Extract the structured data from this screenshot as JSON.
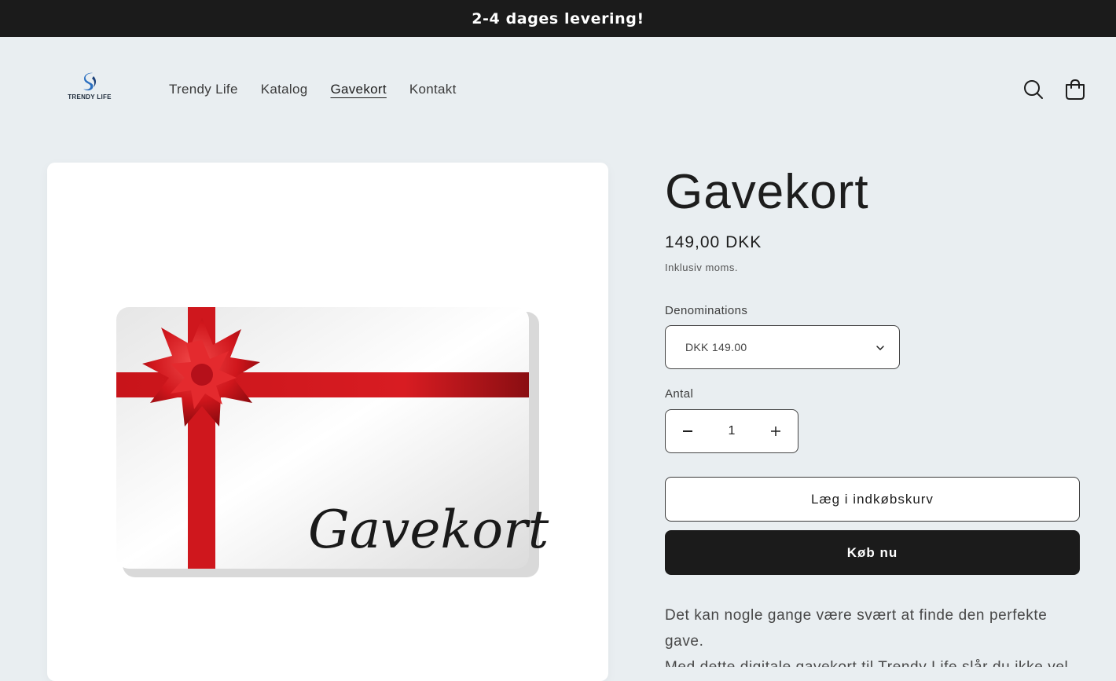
{
  "announcement": {
    "text": "2-4 dages levering!"
  },
  "header": {
    "logo_text": "TRENDY LIFE",
    "logo_icon": "trendy-life-logo",
    "nav": [
      {
        "label": "Trendy Life",
        "active": false
      },
      {
        "label": "Katalog",
        "active": false
      },
      {
        "label": "Gavekort",
        "active": true
      },
      {
        "label": "Kontakt",
        "active": false
      }
    ],
    "icons": {
      "search": "search-icon",
      "cart": "cart-icon"
    }
  },
  "product": {
    "image_text": "Gavekort",
    "title": "Gavekort",
    "price": "149,00 DKK",
    "tax_note": "Inklusiv moms.",
    "denominations": {
      "label": "Denominations",
      "selected": "DKK 149.00"
    },
    "quantity": {
      "label": "Antal",
      "value": "1",
      "minus_icon": "minus-icon",
      "plus_icon": "plus-icon"
    },
    "add_to_cart_label": "Læg i indkøbskurv",
    "buy_now_label": "Køb nu",
    "description": [
      "Det kan nogle gange være svært at finde den perfekte gave.",
      "Med dette digitale gavekort til Trendy Life slår du ikke vel"
    ]
  },
  "colors": {
    "accent": "#1b1b1b",
    "background": "#e9eef1",
    "ribbon": "#d3171e"
  }
}
